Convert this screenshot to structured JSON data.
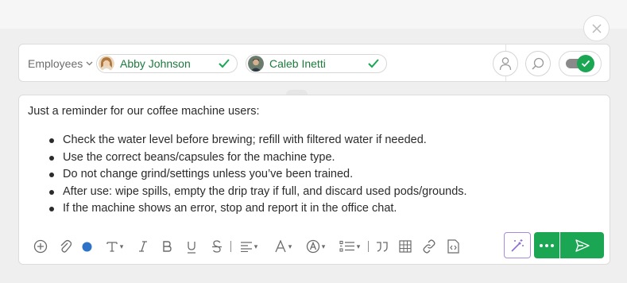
{
  "recipients": {
    "type_label": "Employees",
    "chips": [
      {
        "name": "Abby Johnson"
      },
      {
        "name": "Caleb Inetti"
      }
    ]
  },
  "message": {
    "intro": "Just a reminder for our coffee machine users:",
    "bullets": [
      "Check the water level before brewing; refill with filtered water if needed.",
      "Use the correct beans/capsules for the machine type.",
      "Do not change grind/settings unless you’ve been trained.",
      "After use: wipe spills, empty the drip tray if full, and discard used pods/grounds.",
      "If the machine shows an error, stop and report it in the office chat."
    ]
  },
  "toolbar": {
    "icons": [
      "plus-circle-icon",
      "paperclip-icon",
      "color-dot-icon",
      "text-size-icon",
      "italic-icon",
      "bold-icon",
      "underline-icon",
      "strikethrough-icon",
      "align-icon",
      "font-icon",
      "text-style-icon",
      "list-icon",
      "quote-icon",
      "table-icon",
      "link-icon",
      "code-icon"
    ]
  },
  "colors": {
    "accent": "#1aa653",
    "contact_name": "#1d7a3c",
    "ai_border": "#a58cdf",
    "color_dot": "#2f73c9"
  }
}
